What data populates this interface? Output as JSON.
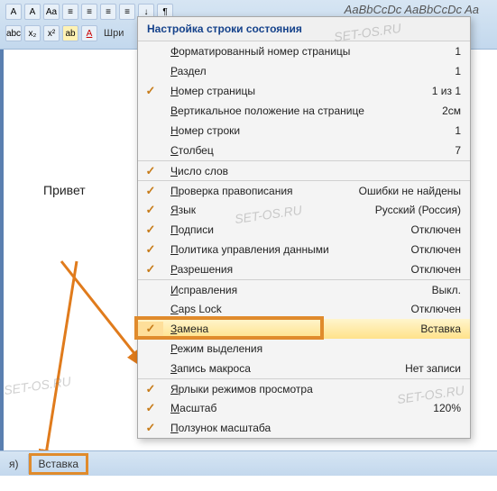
{
  "ribbon": {
    "font_group_label": "Шри",
    "style_preview": "AaBbCcDc  AaBbCcDc  Aa"
  },
  "document": {
    "sample_text": "Привет"
  },
  "statusbar": {
    "item1": "я)",
    "item2": "Вставка"
  },
  "menu": {
    "title": "Настройка строки состояния",
    "items": [
      {
        "checked": false,
        "label": "Форматированный номер страницы",
        "value": "1",
        "sep": false
      },
      {
        "checked": false,
        "label": "Раздел",
        "value": "1",
        "sep": false
      },
      {
        "checked": true,
        "label": "Номер страницы",
        "value": "1 из 1",
        "sep": false
      },
      {
        "checked": false,
        "label": "Вертикальное положение на странице",
        "value": "2см",
        "sep": false
      },
      {
        "checked": false,
        "label": "Номер строки",
        "value": "1",
        "sep": false
      },
      {
        "checked": false,
        "label": "Столбец",
        "value": "7",
        "sep": false
      },
      {
        "checked": true,
        "label": "Число слов",
        "value": "",
        "sep": true
      },
      {
        "checked": true,
        "label": "Проверка правописания",
        "value": "Ошибки не найдены",
        "sep": true
      },
      {
        "checked": true,
        "label": "Язык",
        "value": "Русский (Россия)",
        "sep": false
      },
      {
        "checked": true,
        "label": "Подписи",
        "value": "Отключен",
        "sep": false
      },
      {
        "checked": true,
        "label": "Политика управления данными",
        "value": "Отключен",
        "sep": false
      },
      {
        "checked": true,
        "label": "Разрешения",
        "value": "Отключен",
        "sep": false
      },
      {
        "checked": false,
        "label": "Исправления",
        "value": "Выкл.",
        "sep": true
      },
      {
        "checked": false,
        "label": "Caps Lock",
        "value": "Отключен",
        "sep": false
      },
      {
        "checked": true,
        "label": "Замена",
        "value": "Вставка",
        "sep": false,
        "highlight": true
      },
      {
        "checked": false,
        "label": "Режим выделения",
        "value": "",
        "sep": false
      },
      {
        "checked": false,
        "label": "Запись макроса",
        "value": "Нет записи",
        "sep": false
      },
      {
        "checked": true,
        "label": "Ярлыки режимов просмотра",
        "value": "",
        "sep": true
      },
      {
        "checked": true,
        "label": "Масштаб",
        "value": "120%",
        "sep": false
      },
      {
        "checked": true,
        "label": "Ползунок масштаба",
        "value": "",
        "sep": false
      }
    ]
  },
  "annotation": {
    "watermark": "SET-OS.RU"
  }
}
